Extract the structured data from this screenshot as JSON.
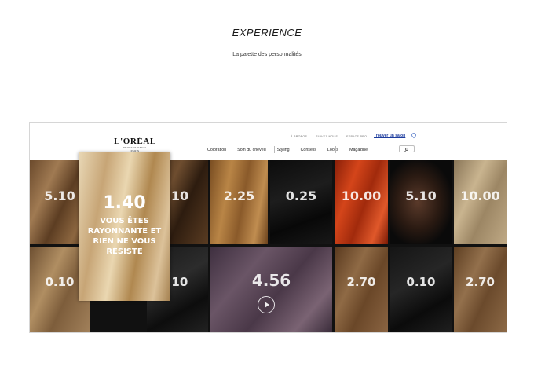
{
  "page": {
    "heading": "EXPERIENCE",
    "subheading": "La palette des personnalités"
  },
  "site": {
    "logo": {
      "main": "L'ORÉAL",
      "sub": "PROFESSIONNEL",
      "sub2": "PARIS"
    },
    "top_links": [
      "À PROPOS",
      "SUIVEZ-NOUS",
      "ESPACE PRO"
    ],
    "salon_link": "Trouver un salon",
    "nav": [
      "Coloration",
      "Soin du cheveu",
      "Styling",
      "Conseils",
      "Looks",
      "Magazine"
    ],
    "search_icon": "search-icon",
    "location_icon": "pin-icon"
  },
  "feature": {
    "shade": "1.40",
    "tagline": "VOUS ÊTES RAYONNANTE ET RIEN NE VOUS RÉSISTE"
  },
  "swatches_top": [
    "5.10",
    ".10",
    "2.25",
    "0.25",
    "10.00",
    "5.10",
    "10.00"
  ],
  "swatches_bottom": [
    "0.10",
    ".10",
    "4.56",
    "2.70",
    "0.10",
    "2.70"
  ],
  "colors": {
    "link": "#1d3c9e",
    "mosaic_bg": "#111111"
  }
}
